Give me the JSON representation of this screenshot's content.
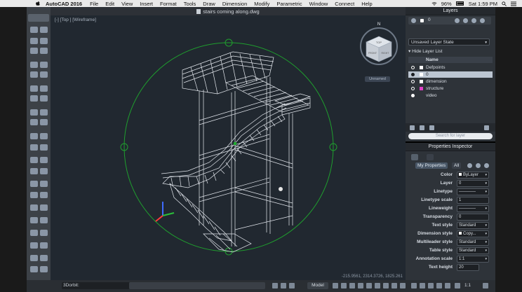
{
  "menubar": {
    "app_name": "AutoCAD 2016",
    "menus": [
      "File",
      "Edit",
      "View",
      "Insert",
      "Format",
      "Tools",
      "Draw",
      "Dimension",
      "Modify",
      "Parametric",
      "Window",
      "Connect",
      "Help"
    ],
    "battery": "96%",
    "time": "Sat 1:59 PM"
  },
  "document": {
    "title": "stairs coming along.dwg"
  },
  "viewport": {
    "view_label": "[-] [Top ] [Wireframe]",
    "unnamed": "Unnamed",
    "coordinates": "-215.9561, 2314.3726, 1825.261"
  },
  "viewcube": {
    "top": "TOP",
    "front": "FRONT",
    "right": "RIGHT",
    "north": "N"
  },
  "layers": {
    "title": "Layers",
    "current_layer": "0",
    "state": "Unsaved Layer State",
    "hide_list": "Hide Layer List",
    "col_name": "Name",
    "items": [
      {
        "name": "Defpoints",
        "color": "#ffffff"
      },
      {
        "name": "0",
        "color": "#ffffff",
        "selected": true
      },
      {
        "name": "dimension",
        "color": "#ffffff"
      },
      {
        "name": "structure",
        "color": "#e040c8"
      },
      {
        "name": "video",
        "color": "#ffffff"
      }
    ],
    "search_placeholder": "Search for layer"
  },
  "properties": {
    "title": "Properties Inspector",
    "tab_my": "My Properties",
    "tab_all": "All",
    "rows": [
      {
        "label": "Color",
        "value": "ByLayer"
      },
      {
        "label": "Layer",
        "value": "0"
      },
      {
        "label": "Linetype",
        "value": ""
      },
      {
        "label": "Linetype scale",
        "value": "1"
      },
      {
        "label": "Lineweight",
        "value": ""
      },
      {
        "label": "Transparency",
        "value": "0"
      },
      {
        "label": "Text style",
        "value": "Standard"
      },
      {
        "label": "Dimension style",
        "value": "Copy..."
      },
      {
        "label": "Multileader style",
        "value": "Standard"
      },
      {
        "label": "Table style",
        "value": "Standard"
      },
      {
        "label": "Annotation scale",
        "value": "1:1"
      },
      {
        "label": "Text height",
        "value": "20"
      }
    ]
  },
  "status": {
    "command": "3Dorbit:",
    "model": "Model",
    "scale": "1:1"
  }
}
